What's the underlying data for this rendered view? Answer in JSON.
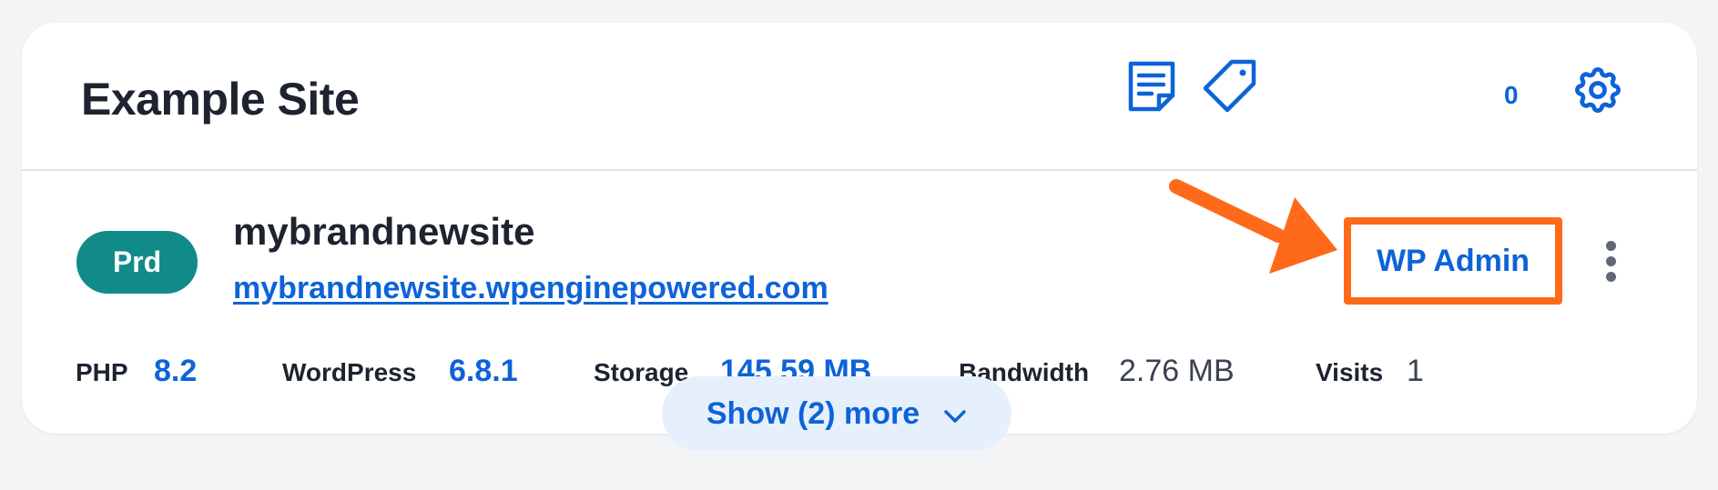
{
  "header": {
    "title": "Example Site",
    "icons": [
      "notes-icon",
      "tag-icon",
      "settings-gear-icon"
    ],
    "tag_count": "0"
  },
  "install": {
    "environment_badge": "Prd",
    "name": "mybrandnewsite",
    "url": "mybrandnewsite.wpenginepowered.com",
    "wp_admin_label": "WP Admin",
    "more_options_icon": "kebab-menu-icon"
  },
  "stats": {
    "php_label": "PHP",
    "php_value": "8.2",
    "wordpress_label": "WordPress",
    "wordpress_value": "6.8.1",
    "storage_label": "Storage",
    "storage_value": "145.59 MB",
    "bandwidth_label": "Bandwidth",
    "bandwidth_value": "2.76 MB",
    "visits_label": "Visits",
    "visits_value": "1"
  },
  "show_more": {
    "label": "Show (2) more",
    "icon": "chevron-down-icon"
  },
  "colors": {
    "accent": "#0d63d8",
    "badge": "#118a8a",
    "highlight": "#ff6a1a",
    "background": "#f3f4f6"
  }
}
